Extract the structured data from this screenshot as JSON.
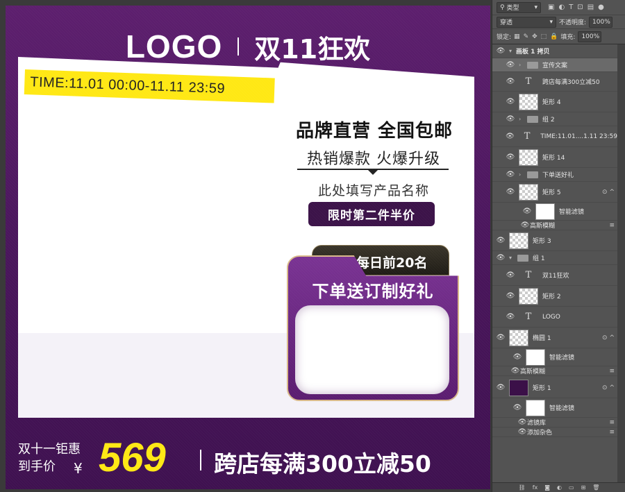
{
  "artboard": {
    "logo": "LOGO",
    "title": "双11狂欢",
    "time": "TIME:11.01 00:00-11.11 23:59",
    "headline": "品牌直营 全国包邮",
    "sub_headline": "热销爆款 火爆升级",
    "product_name": "此处填写产品名称",
    "promo_pill": "限时第二件半价",
    "gift_tab": "每日前20名",
    "gift_title": "下单送订制好礼",
    "price_label_line1": "双十一钜惠",
    "price_label_line2": "到手价",
    "currency": "¥",
    "price": "569",
    "bottom_offer": "跨店每满300立减50",
    "colors": {
      "purple": "#4a165c",
      "yellow": "#ffe814"
    }
  },
  "layers_panel": {
    "filter_kind": "类型",
    "blend_mode": "穿透",
    "opacity_label": "不透明度:",
    "opacity_value": "100%",
    "lock_label": "锁定:",
    "fill_label": "填充:",
    "fill_value": "100%",
    "layers": [
      {
        "name": "画板 1 拷贝",
        "kind": "artboard"
      },
      {
        "name": "宣传文案",
        "kind": "group",
        "selected": true
      },
      {
        "name": "跨店每满300立减50",
        "kind": "text"
      },
      {
        "name": "矩形 4",
        "kind": "shape"
      },
      {
        "name": "组 2",
        "kind": "group"
      },
      {
        "name": "TIME:11.01....1.11 23:59",
        "kind": "text"
      },
      {
        "name": "矩形 14",
        "kind": "shape"
      },
      {
        "name": "下单送好礼",
        "kind": "group"
      },
      {
        "name": "矩形 5",
        "kind": "shape",
        "fx": true
      },
      {
        "name": "智能滤镜",
        "kind": "filter"
      },
      {
        "name": "高斯模糊",
        "kind": "effect"
      },
      {
        "name": "矩形 3",
        "kind": "shape"
      },
      {
        "name": "组 1",
        "kind": "group"
      },
      {
        "name": "双11狂欢",
        "kind": "text"
      },
      {
        "name": "矩形 2",
        "kind": "shape"
      },
      {
        "name": "LOGO",
        "kind": "text"
      },
      {
        "name": "椭圆 1",
        "kind": "shape",
        "fx": true
      },
      {
        "name": "智能滤镜",
        "kind": "filter"
      },
      {
        "name": "高斯模糊",
        "kind": "effect"
      },
      {
        "name": "矩形 1",
        "kind": "shape",
        "fx": true
      },
      {
        "name": "智能滤镜",
        "kind": "filter"
      },
      {
        "name": "滤镜库",
        "kind": "effect"
      },
      {
        "name": "添加杂色",
        "kind": "effect"
      }
    ]
  }
}
